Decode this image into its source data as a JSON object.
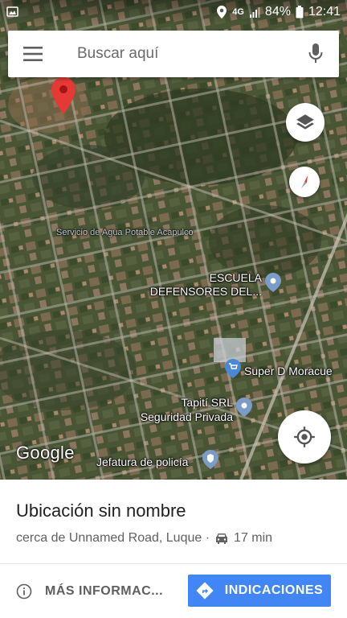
{
  "status_bar": {
    "network": "4G",
    "battery": "84%",
    "time": "12:41"
  },
  "search": {
    "placeholder": "Buscar aquí"
  },
  "map": {
    "labels": {
      "water_service": "Servicio de Agua Potable Acapulco",
      "school": "ESCUELA DEFENSORES DEL...",
      "supermarket": "Super D Moracue",
      "security_company": "Tapití SRL Seguridad Privada",
      "police": "Jefatura de policía"
    },
    "attribution": "Google"
  },
  "place": {
    "title": "Ubicación sin nombre",
    "address": "cerca de Unnamed Road, Luque ·",
    "drive_time": "17 min"
  },
  "actions": {
    "more_info": "MÁS INFORMAC...",
    "directions": "INDICACIONES"
  },
  "colors": {
    "accent": "#4285f4",
    "pin": "#e53935",
    "poi_pin": "#4a88d6"
  }
}
